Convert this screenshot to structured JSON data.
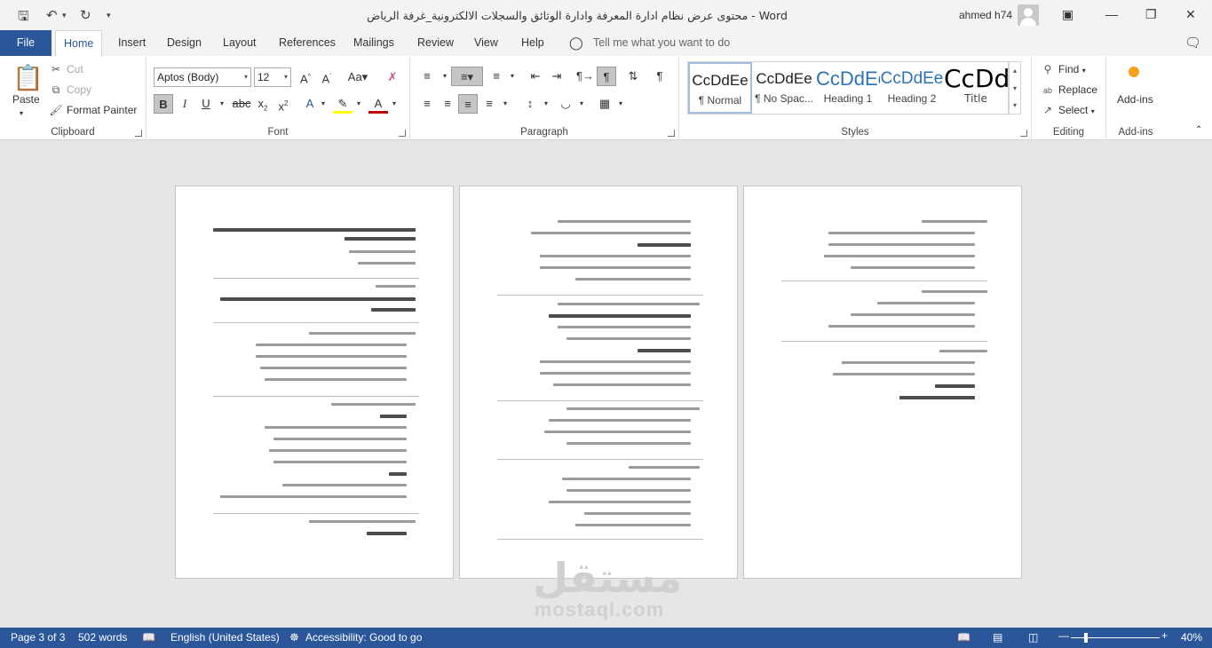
{
  "titlebar": {
    "title": "محتوى عرض نظام ادارة المعرفة وادارة الوثائق والسجلات الالكترونية_غرفة الرياض  -  Word",
    "user": "ahmed h74"
  },
  "tabs": {
    "file": "File",
    "items": [
      "Home",
      "Insert",
      "Design",
      "Layout",
      "References",
      "Mailings",
      "Review",
      "View",
      "Help"
    ],
    "tell_me": "Tell me what you want to do"
  },
  "clipboard": {
    "paste": "Paste",
    "cut": "Cut",
    "copy": "Copy",
    "format_painter": "Format Painter",
    "label": "Clipboard"
  },
  "font": {
    "name": "Aptos (Body)",
    "size": "12",
    "label": "Font"
  },
  "paragraph": {
    "label": "Paragraph"
  },
  "styles": {
    "items": [
      {
        "preview": "CcDdEe",
        "name": "¶ Normal"
      },
      {
        "preview": "CcDdEe",
        "name": "¶ No Spac..."
      },
      {
        "preview": "CcDdEe",
        "name": "Heading 1"
      },
      {
        "preview": "CcDdEe",
        "name": "Heading 2"
      },
      {
        "preview": "CcDdEe",
        "name": "Title"
      }
    ],
    "label": "Styles"
  },
  "editing": {
    "find": "Find",
    "replace": "Replace",
    "select": "Select",
    "label": "Editing"
  },
  "addins": {
    "button": "Add-ins",
    "label": "Add-ins"
  },
  "watermark": {
    "arabic": "مستقل",
    "latin": "mostaql.com"
  },
  "status": {
    "page": "Page 3 of 3",
    "words": "502 words",
    "language": "English (United States)",
    "accessibility": "Accessibility: Good to go",
    "zoom": "40%"
  },
  "colors": {
    "brand": "#2b579a",
    "highlight": "#ffff00",
    "font_color": "#c00000"
  }
}
